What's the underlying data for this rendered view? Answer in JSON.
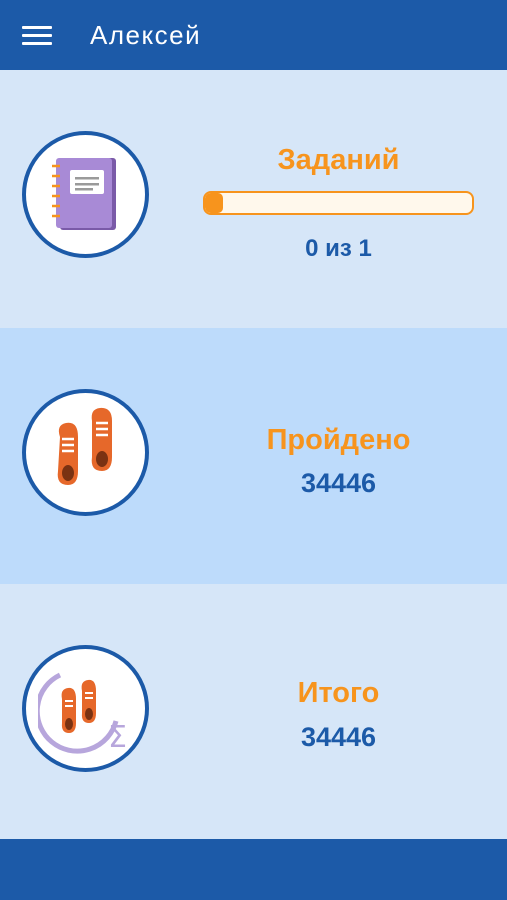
{
  "appbar": {
    "title": "Алексей",
    "menu_icon": "hamburger-menu-icon"
  },
  "cards": {
    "tasks": {
      "label": "Заданий",
      "progress_fraction": 0.0,
      "value": "0 из 1",
      "icon": "notebook-icon"
    },
    "passed": {
      "label": "Пройдено",
      "value": "34446",
      "icon": "sneakers-icon"
    },
    "total": {
      "label": "Итого",
      "value": "34446",
      "icon": "sneakers-sum-icon"
    }
  },
  "colors": {
    "primary": "#1c5aa8",
    "accent": "#f7941d",
    "light_bg": "#d6e6f8",
    "mid_bg": "#bddbfb"
  }
}
